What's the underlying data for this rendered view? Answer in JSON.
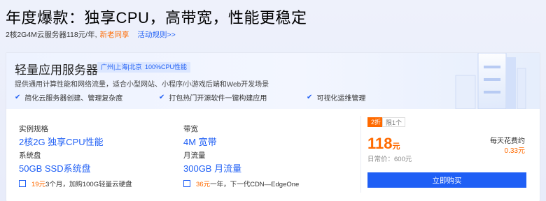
{
  "header": {
    "headline": "年度爆款：独享CPU，高带宽，性能更稳定",
    "sub_text": "2核2G4M云服务器118元/年,",
    "new_user_tag": "新老同享",
    "rules_link": "活动规则>>"
  },
  "product": {
    "title": "轻量应用服务器",
    "badges": [
      "广州|上海|北京",
      "100%CPU性能"
    ],
    "description": "提供通用计算性能和网络流量，适合小型网站、小程序/小游戏后端和Web开发场景",
    "features": [
      "简化云服务器创建、管理复杂度",
      "打包热门开源软件一键构建应用",
      "可视化运维管理"
    ],
    "specs": [
      {
        "label": "实例规格",
        "value": "2核2G 独享CPU性能"
      },
      {
        "label": "带宽",
        "value": "4M 宽带"
      },
      {
        "label": "系统盘",
        "value": "50GB SSD系统盘"
      },
      {
        "label": "月流量",
        "value": "300GB 月流量"
      }
    ],
    "addons": [
      {
        "price": "19元",
        "text": "3个月，加购100G轻量云硬盘"
      },
      {
        "price": "36元",
        "text": "一年，下一代CDN—EdgeOne"
      }
    ]
  },
  "pricing": {
    "discount_tag": "2折",
    "limit_tag": "限1个",
    "price_number": "118",
    "price_unit": "元",
    "original_price": "日常价：600元",
    "daily_label": "每天花费约",
    "daily_value": "0.33元",
    "buy_label": "立即购买"
  },
  "colors": {
    "accent": "#1f5ff5",
    "price": "#ff6a00"
  },
  "icons": {
    "feature": "check-icon",
    "addon": "checkbox-icon"
  }
}
